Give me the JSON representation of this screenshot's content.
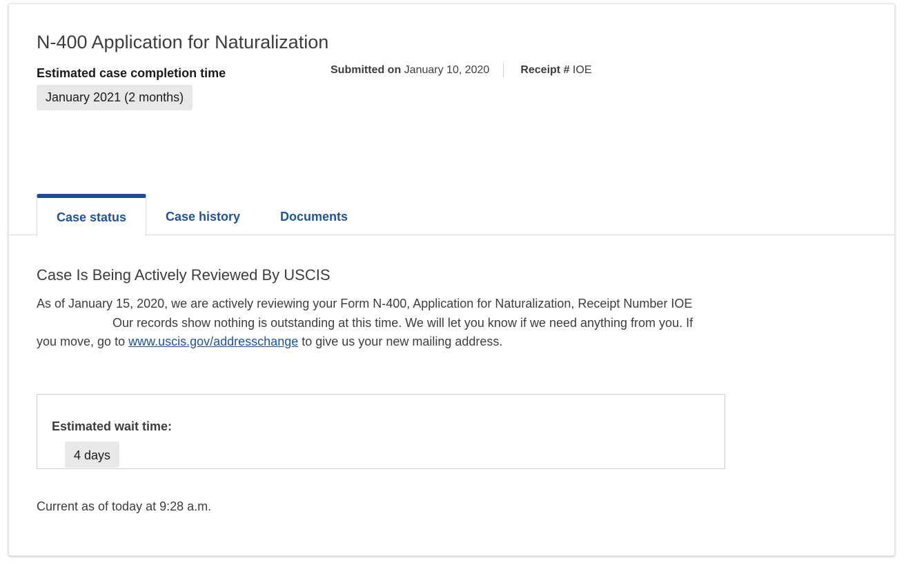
{
  "page_title": "N-400 Application for Naturalization",
  "estimate": {
    "label": "Estimated case completion time",
    "value": "January 2021 (2 months)"
  },
  "meta": {
    "submitted_label": "Submitted on",
    "submitted_value": "January 10, 2020",
    "receipt_label": "Receipt #",
    "receipt_value": "IOE"
  },
  "tabs": [
    {
      "label": "Case status",
      "active": true
    },
    {
      "label": "Case history",
      "active": false
    },
    {
      "label": "Documents",
      "active": false
    }
  ],
  "status": {
    "heading": "Case Is Being Actively Reviewed By USCIS",
    "body_part1": "As of January 15, 2020, we are actively reviewing your Form N-400, Application for Naturalization, Receipt Number IOE",
    "body_part2": "Our records show nothing is outstanding at this time. We will let you know if we need anything from you. If you move, go to",
    "link_text": "www.uscis.gov/addresschange",
    "body_part3": "to give us your new mailing address."
  },
  "wait": {
    "label": "Estimated wait time:",
    "value": "4 days"
  },
  "current_as_of": "Current as of today at 9:28 a.m.",
  "colors": {
    "tab_accent": "#1f4e92",
    "link": "#205493",
    "badge_bg": "#e8e8e8"
  }
}
